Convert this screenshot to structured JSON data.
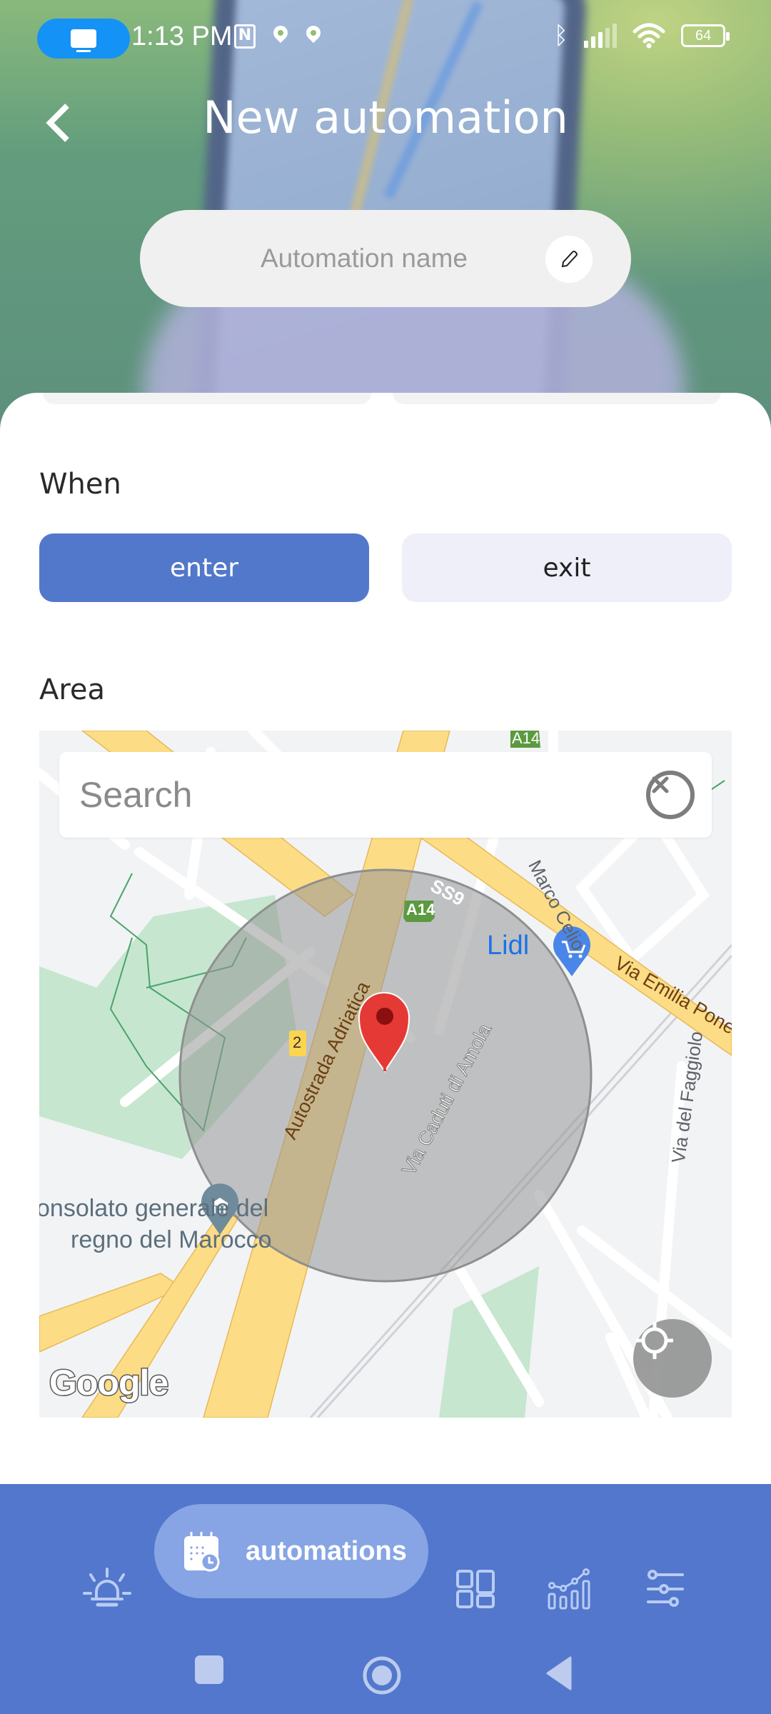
{
  "status_bar": {
    "time": "1:13 PM",
    "battery": "64",
    "icons": [
      "screen-mirror-icon",
      "nfc-icon",
      "location-icon",
      "location-icon",
      "bluetooth-icon",
      "signal-icon",
      "wifi-icon",
      "battery-icon"
    ]
  },
  "header": {
    "title": "New automation",
    "back_icon": "chevron-left-icon"
  },
  "name_field": {
    "placeholder": "Automation name",
    "value": "",
    "edit_icon": "pencil-icon"
  },
  "when": {
    "label": "When",
    "options": [
      {
        "label": "enter",
        "selected": true
      },
      {
        "label": "exit",
        "selected": false
      }
    ]
  },
  "area": {
    "label": "Area",
    "search": {
      "placeholder": "Search",
      "value": "",
      "clear_icon": "close-circle-icon"
    },
    "map": {
      "attribution": "Google",
      "labels": {
        "road_a14_top": "A14",
        "road_a14": "A14",
        "road_ss9": "SS9",
        "autostrada": "Autostrada Adriatica",
        "marco_celio": "Marco Celio",
        "lidl": "Lidl",
        "via_emilia": "Via Emilia Ponente",
        "via_caduti": "Via Caduti di Amola",
        "via_faggiolo": "Via del Faggiolo",
        "consolato_1": "onsolato generale del",
        "consolato_2": "regno del Marocco",
        "exit_number": "2"
      },
      "locate_icon": "my-location-icon",
      "marker_icon": "map-pin-icon"
    }
  },
  "bottom_nav": {
    "items": [
      {
        "icon": "alarm-light-icon",
        "label": ""
      },
      {
        "icon": "calendar-clock-icon",
        "label": "automations",
        "active": true
      },
      {
        "icon": "dashboard-icon",
        "label": ""
      },
      {
        "icon": "chart-icon",
        "label": ""
      },
      {
        "icon": "sliders-icon",
        "label": ""
      }
    ]
  },
  "system_nav": {
    "items": [
      "recents-icon",
      "home-icon",
      "back-icon"
    ]
  },
  "colors": {
    "accent": "#5278cb",
    "nav_bg": "#5277cc",
    "nav_active": "#87a5e4",
    "toggle_inactive": "#eeeff9"
  }
}
